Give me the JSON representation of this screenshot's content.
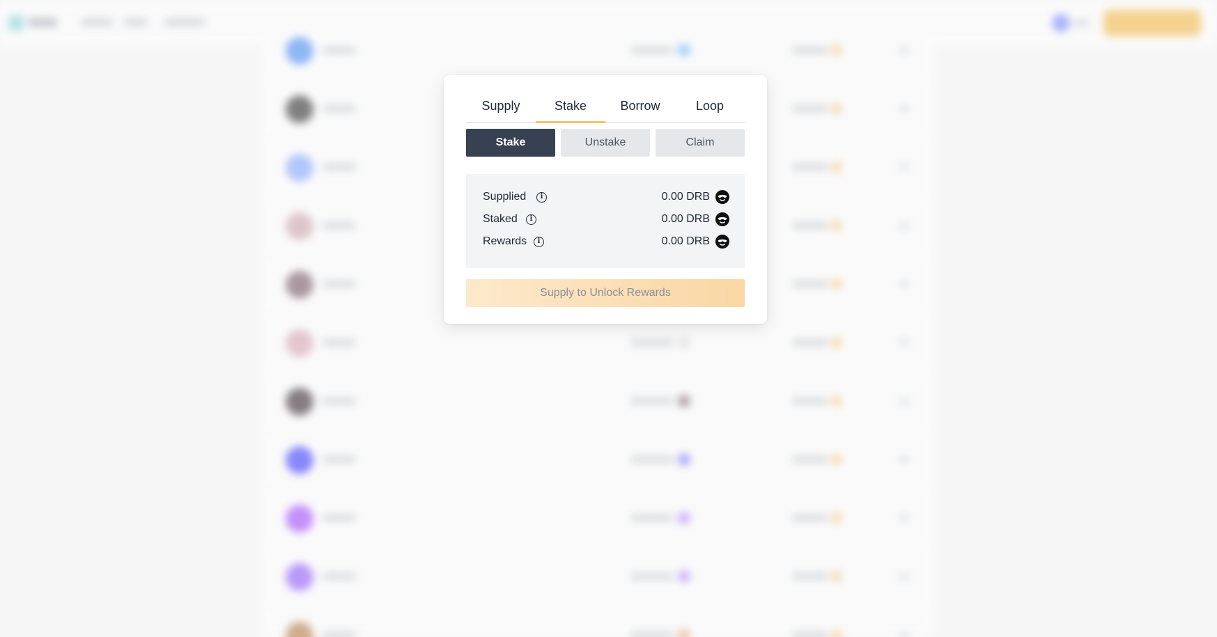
{
  "tabs": [
    {
      "label": "Supply",
      "active": false
    },
    {
      "label": "Stake",
      "active": true
    },
    {
      "label": "Borrow",
      "active": false
    },
    {
      "label": "Loop",
      "active": false
    }
  ],
  "stake_actions": [
    {
      "label": "Stake",
      "active": true
    },
    {
      "label": "Unstake",
      "active": false
    },
    {
      "label": "Claim",
      "active": false
    }
  ],
  "info": {
    "supplied": {
      "label": "Supplied",
      "value": "0.00 DRB",
      "icon": "info-icon"
    },
    "staked": {
      "label": "Staked",
      "value": "0.00 DRB",
      "icon": "info-icon"
    },
    "rewards": {
      "label": "Rewards",
      "value": "0.00 DRB",
      "icon": "info-icon"
    },
    "token_icon": "drb-token-icon"
  },
  "cta": {
    "label": "Supply to Unlock Rewards",
    "disabled": true
  },
  "colors": {
    "accent": "#f5c26b",
    "active_segment": "#374151",
    "cta_gradient_start": "#fde9cc",
    "cta_gradient_end": "#fad7a4"
  },
  "background_rows": {
    "avatar_colors": [
      "#3b82f6",
      "#1f1f1f",
      "#7aa0ff",
      "#c9a0a8",
      "#6b4c5a",
      "#d4a0b0",
      "#2a1a24",
      "#2d2dff",
      "#9b3dff",
      "#8a4dff",
      "#b0723a"
    ],
    "value_icon_colors": [
      "#5aa9ff",
      "",
      "",
      "",
      "",
      "#d8d8d8",
      "#7a5a66",
      "#6a6aff",
      "#b07aff",
      "#b07aff",
      "#e0a070"
    ]
  }
}
